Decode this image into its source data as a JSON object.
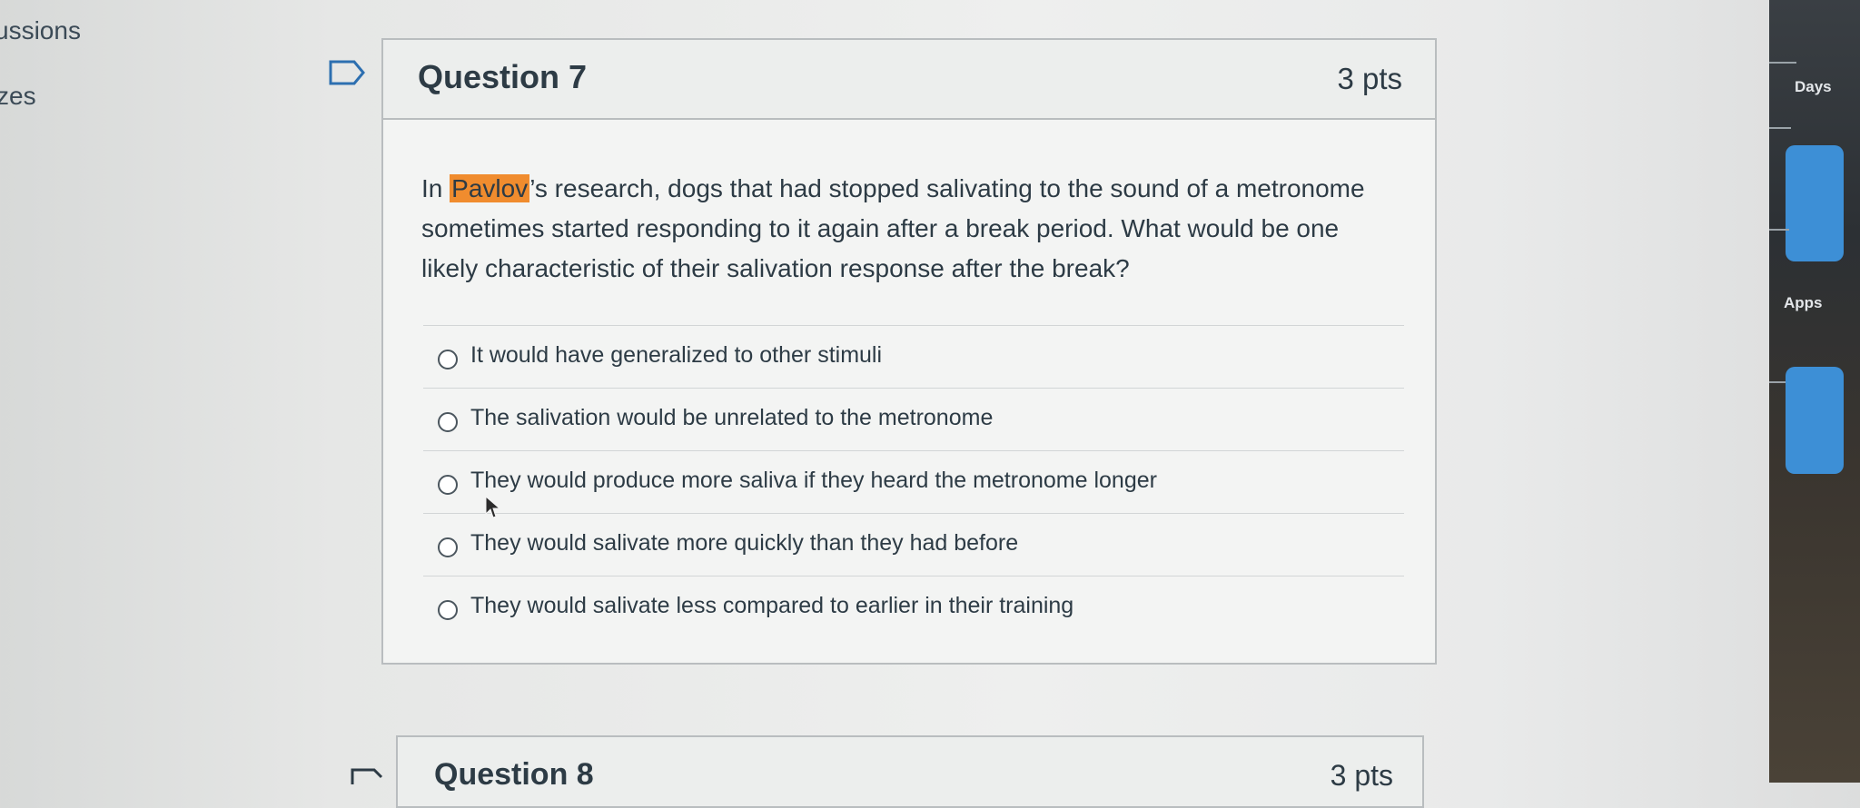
{
  "nav": {
    "discussions_fragment": "ussions",
    "quizzes_fragment": "zes"
  },
  "question": {
    "title": "Question 7",
    "points": "3 pts",
    "text_before": "In ",
    "text_highlight": "Pavlov",
    "text_after": "’s research, dogs that had stopped salivating to the sound of a metronome sometimes started responding to it again after a break period. What would be one likely characteristic of their salivation response after the break?",
    "answers": [
      "It would have generalized to other stimuli",
      "The salivation would be unrelated to the metronome",
      "They would produce more saliva if they heard the metronome longer",
      "They would salivate more quickly than they had before",
      "They would salivate less compared to earlier in their training"
    ]
  },
  "next_question": {
    "title": "Question 8",
    "points": "3 pts"
  },
  "right_panel": {
    "days_label": "Days",
    "apps_label": "Apps"
  },
  "colors": {
    "highlight": "#f08c2e",
    "text": "#2d3b45",
    "card_border": "#b9bdbf",
    "tile": "#3d8fd6"
  }
}
